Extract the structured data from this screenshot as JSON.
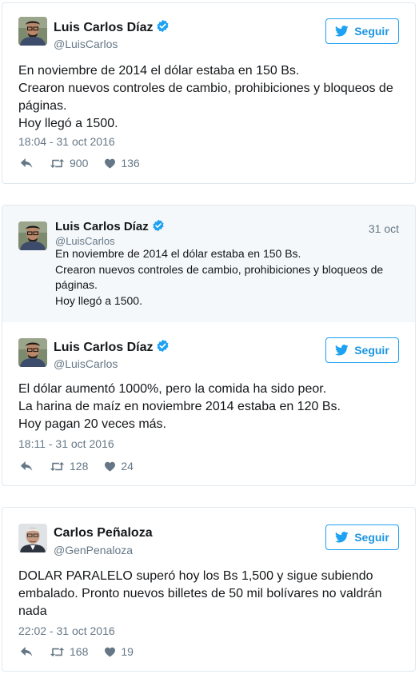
{
  "tweets": [
    {
      "author": "Luis Carlos Díaz",
      "handle": "@LuisCarlos",
      "follow_label": "Seguir",
      "lines": [
        "En noviembre de 2014 el dólar estaba en 150 Bs.",
        "Crearon nuevos controles de cambio, prohibiciones y bloqueos de",
        "páginas.",
        "Hoy llegó a 1500."
      ],
      "timestamp": "18:04 - 31 oct 2016",
      "retweets": "900",
      "likes": "136"
    },
    {
      "quoted": {
        "author": "Luis Carlos Díaz",
        "handle": "@LuisCarlos",
        "date": "31 oct",
        "lines": [
          "En noviembre de 2014 el dólar estaba en 150 Bs.",
          "Crearon nuevos controles de cambio, prohibiciones y bloqueos de",
          "páginas.",
          "Hoy llegó a 1500."
        ]
      },
      "author": "Luis Carlos Díaz",
      "handle": "@LuisCarlos",
      "follow_label": "Seguir",
      "lines": [
        "El dólar aumentó 1000%, pero la comida ha sido peor.",
        "La harina de maíz en noviembre 2014 estaba en 120 Bs.",
        "Hoy pagan 20 veces más."
      ],
      "timestamp": "18:11 - 31 oct 2016",
      "retweets": "128",
      "likes": "24"
    },
    {
      "author": "Carlos Peñaloza",
      "handle": "@GenPenaloza",
      "follow_label": "Seguir",
      "lines": [
        "DOLAR PARALELO superó hoy los Bs 1,500 y sigue subiendo",
        "embalado. Pronto nuevos billetes de 50 mil bolívares no valdrán",
        "nada"
      ],
      "timestamp": "22:02 - 31 oct 2016",
      "retweets": "168",
      "likes": "19"
    }
  ],
  "colors": {
    "twitter_blue": "#1da1f2",
    "text": "#14171a",
    "muted": "#657786",
    "quote_bg": "#f5f8fa",
    "border": "#e1e8ed"
  },
  "icons": [
    "verified-badge-icon",
    "twitter-bird-icon",
    "reply-icon",
    "retweet-icon",
    "heart-icon"
  ]
}
